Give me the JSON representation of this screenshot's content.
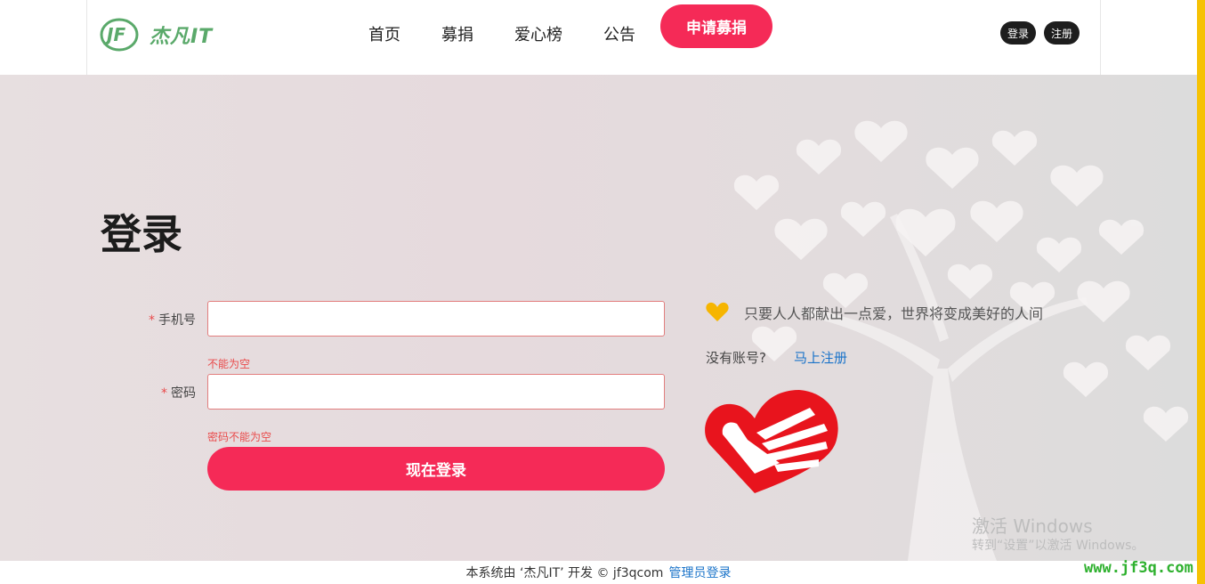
{
  "header": {
    "logo_text": "杰凡IT",
    "logo_mark": "JF",
    "nav": [
      "首页",
      "募捐",
      "爱心榜",
      "公告"
    ],
    "apply_button": "申请募捐",
    "login_button": "登录",
    "register_button": "注册"
  },
  "form": {
    "title": "登录",
    "phone_label": "手机号",
    "phone_value": "",
    "phone_error": "不能为空",
    "password_label": "密码",
    "password_value": "",
    "password_error": "密码不能为空",
    "required_mark": "*",
    "submit_label": "现在登录"
  },
  "side": {
    "slogan": "只要人人都献出一点爱，世界将变成美好的人间",
    "no_account": "没有账号?",
    "register_link": "马上注册"
  },
  "watermark": {
    "line1": "激活 Windows",
    "line2": "转到“设置”以激活 Windows。"
  },
  "footer": {
    "text": "本系统由 ‘杰凡IT’ 开发 © jf3qcom",
    "admin_link": "管理员登录"
  },
  "site_url": "www.jf3q.com",
  "colors": {
    "accent": "#f52a57",
    "logo": "#5aa96a",
    "link": "#1a73c9",
    "error": "#e94b4b",
    "heart": "#f6b500",
    "sidebar": "#f6c204"
  },
  "icons": [
    "heart-icon",
    "charity-hand-icon",
    "logo-icon"
  ]
}
